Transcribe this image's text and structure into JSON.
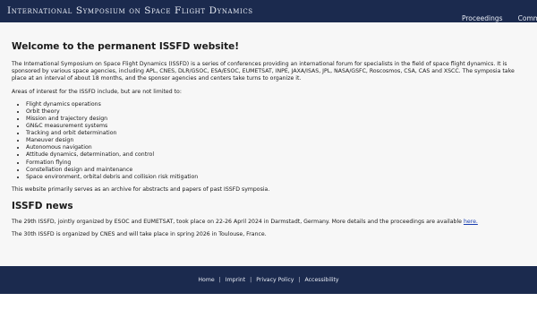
{
  "header": {
    "site_title": "International Symposium on Space Flight Dynamics",
    "nav": [
      "Proceedings",
      "Committ"
    ]
  },
  "main": {
    "heading": "Welcome to the permanent ISSFD website!",
    "intro": "The International Symposium on Space Flight Dynamics (ISSFD) is a series of conferences providing an international forum for specialists in the field of space flight dynamics. It is sponsored by various space agencies, including APL, CNES, DLR/GSOC, ESA/ESOC, EUMETSAT, INPE, JAXA/ISAS, JPL, NASA/GSFC, Roscosmos, CSA, CAS and XSCC. The symposia take place at an interval of about 18 months, and the sponsor agencies and centers take turns to organize it.",
    "areas_intro": "Areas of interest for the ISSFD include, but are not limited to:",
    "areas": [
      "Flight dynamics operations",
      "Orbit theory",
      "Mission and trajectory design",
      "GN&C measurement systems",
      "Tracking and orbit determination",
      "Maneuver design",
      "Autonomous navigation",
      "Attitude dynamics, determination, and control",
      "Formation flying",
      "Constellation design and maintenance",
      "Space environment, orbital debris and collision risk mitigation"
    ],
    "archive_note": "This website primarily serves as an archive for abstracts and papers of past ISSFD symposia.",
    "news_heading": "ISSFD news",
    "news_1": "The 29th ISSFD, jointly organized by ESOC and EUMETSAT, took place on 22-26 April 2024 in Darmstadt, Germany. More details and the proceedings are available ",
    "news_1_link": "here.",
    "news_2": "The 30th ISSFD is organized by CNES and will take place in spring 2026 in Toulouse, France."
  },
  "footer": {
    "links": [
      "Home",
      "Imprint",
      "Privacy Policy",
      "Accessibility"
    ],
    "separator": "|"
  }
}
